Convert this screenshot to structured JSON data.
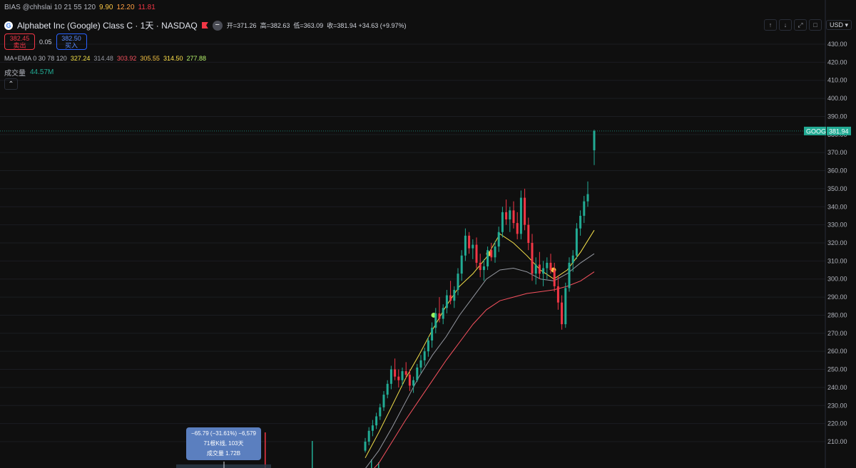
{
  "bias": {
    "label": "BIAS @chhslai 10 21 55 120",
    "values": [
      "9.90",
      "12.20",
      "11.81"
    ]
  },
  "header": {
    "symbol_title": "Alphabet Inc (Google) Class C · 1天 · NASDAQ",
    "logo_letter": "G",
    "open_label": "开=371.26",
    "high_label": "高=382.63",
    "low_label": "低=363.09",
    "close_label": "收=381.94 +34.63 (+9.97%)"
  },
  "trade": {
    "sell_price": "382.45",
    "sell_label": "卖出",
    "spread": "0.05",
    "buy_price": "382.50",
    "buy_label": "买入"
  },
  "ma_ema": {
    "label": "MA+EMA 0 30 78 120",
    "values": [
      "327.24",
      "314.48",
      "303.92",
      "305.55",
      "314.50",
      "277.88"
    ]
  },
  "volume": {
    "label": "成交量",
    "value": "44.57M"
  },
  "toolbar": {
    "currency": "USD"
  },
  "price_tag": {
    "symbol": "GOOG",
    "price": "381.94"
  },
  "measure": {
    "line1": "−65.79 (−31.61%) −6,579",
    "line2": "71根K线, 103天",
    "line3": "成交量 1.72B"
  },
  "colors": {
    "up": "#22ab94",
    "down": "#f23645",
    "ma30": "#f6e24a",
    "ma78": "#9598a1",
    "ma120": "#f7525f"
  },
  "chart_data": {
    "type": "candlestick",
    "y_axis_ticks": [
      430,
      420,
      410,
      400,
      390,
      380,
      370,
      360,
      350,
      340,
      330,
      320,
      310,
      300,
      290,
      280,
      270,
      260,
      250,
      240,
      230,
      220,
      210
    ],
    "ylim": [
      205,
      435
    ],
    "last_price": 381.94,
    "last_candle": {
      "open": 371.26,
      "high": 382.63,
      "low": 363.09,
      "close": 381.94
    },
    "moving_averages": [
      {
        "name": "MA 30",
        "color": "#f6e24a",
        "values": [
          201,
          215,
          230,
          245,
          258,
          272,
          285,
          296,
          303,
          312,
          325,
          320,
          313,
          305,
          300,
          305,
          315,
          327
        ]
      },
      {
        "name": "MA 78",
        "color": "#9598a1",
        "values": [
          195,
          205,
          218,
          232,
          246,
          258,
          268,
          280,
          290,
          300,
          305,
          306,
          304,
          300,
          299,
          303,
          309,
          314
        ]
      },
      {
        "name": "MA 120",
        "color": "#f7525f",
        "values": [
          190,
          198,
          210,
          222,
          233,
          244,
          255,
          265,
          275,
          283,
          288,
          290,
          292,
          293,
          294,
          296,
          299,
          304
        ]
      }
    ],
    "candles": [
      [
        205,
        212,
        204,
        210
      ],
      [
        210,
        218,
        208,
        216
      ],
      [
        216,
        222,
        213,
        219
      ],
      [
        219,
        226,
        217,
        224
      ],
      [
        224,
        231,
        222,
        229
      ],
      [
        229,
        238,
        227,
        236
      ],
      [
        236,
        244,
        234,
        242
      ],
      [
        242,
        252,
        239,
        250
      ],
      [
        250,
        256,
        244,
        246
      ],
      [
        246,
        250,
        240,
        244
      ],
      [
        244,
        251,
        241,
        249
      ],
      [
        249,
        254,
        245,
        247
      ],
      [
        247,
        250,
        238,
        241
      ],
      [
        241,
        246,
        237,
        244
      ],
      [
        244,
        253,
        243,
        251
      ],
      [
        251,
        258,
        248,
        255
      ],
      [
        255,
        262,
        252,
        260
      ],
      [
        260,
        268,
        257,
        266
      ],
      [
        266,
        276,
        262,
        273
      ],
      [
        273,
        284,
        270,
        281
      ],
      [
        281,
        290,
        276,
        278
      ],
      [
        278,
        286,
        275,
        284
      ],
      [
        284,
        294,
        281,
        291
      ],
      [
        291,
        299,
        286,
        288
      ],
      [
        288,
        296,
        284,
        294
      ],
      [
        294,
        306,
        291,
        303
      ],
      [
        303,
        316,
        299,
        313
      ],
      [
        313,
        328,
        310,
        324
      ],
      [
        324,
        326,
        314,
        317
      ],
      [
        317,
        322,
        311,
        319
      ],
      [
        319,
        323,
        306,
        309
      ],
      [
        309,
        314,
        301,
        305
      ],
      [
        305,
        311,
        299,
        307
      ],
      [
        307,
        318,
        305,
        316
      ],
      [
        316,
        320,
        310,
        312
      ],
      [
        312,
        321,
        309,
        318
      ],
      [
        318,
        329,
        315,
        326
      ],
      [
        326,
        340,
        323,
        337
      ],
      [
        337,
        344,
        330,
        333
      ],
      [
        333,
        340,
        326,
        338
      ],
      [
        338,
        343,
        328,
        331
      ],
      [
        331,
        337,
        322,
        325
      ],
      [
        325,
        349,
        322,
        345
      ],
      [
        345,
        350,
        327,
        330
      ],
      [
        330,
        334,
        316,
        320
      ],
      [
        320,
        325,
        299,
        303
      ],
      [
        303,
        312,
        297,
        308
      ],
      [
        308,
        315,
        300,
        303
      ],
      [
        303,
        310,
        296,
        306
      ],
      [
        306,
        312,
        300,
        309
      ],
      [
        309,
        314,
        303,
        305
      ],
      [
        305,
        309,
        293,
        296
      ],
      [
        296,
        302,
        283,
        287
      ],
      [
        287,
        291,
        272,
        275
      ],
      [
        275,
        298,
        273,
        295
      ],
      [
        295,
        312,
        293,
        309
      ],
      [
        309,
        316,
        304,
        313
      ],
      [
        313,
        331,
        311,
        328
      ],
      [
        328,
        338,
        324,
        335
      ],
      [
        335,
        346,
        331,
        343
      ],
      [
        343,
        354,
        340,
        347
      ],
      [
        371.26,
        382.63,
        363.09,
        381.94
      ]
    ],
    "annotations": [
      "−65.79 (−31.61%) −6,579",
      "71根K线, 103天",
      "成交量 1.72B"
    ]
  }
}
